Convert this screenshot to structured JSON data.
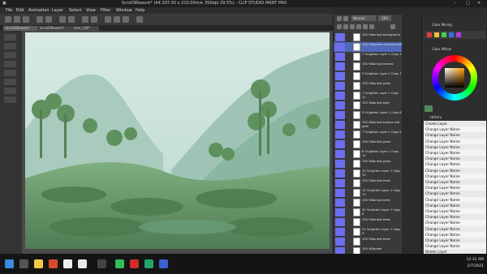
{
  "window": {
    "title": "Scroll3Rework* (A4 297.00 x 210.00mm 350dpi 29.5%) - CLIP STUDIO PAINT PRO"
  },
  "menu": [
    "File",
    "Edit",
    "Animation",
    "Layer",
    "Select",
    "View",
    "Filter",
    "Window",
    "Help"
  ],
  "doc_tabs": [
    "Scroll3Rework*",
    "Scroll3Rework*",
    "tree_v28*"
  ],
  "layer_panel": {
    "blend_mode": "Normal",
    "opacity": "100",
    "layers": [
      {
        "label": "100 %Normal background",
        "selected": false
      },
      {
        "label": "100 %Normal multiplyfusl2",
        "selected": true
      },
      {
        "label": "7 %Lighten Layer 1 Copy 4",
        "selected": false
      },
      {
        "label": "100 %Normal bushes",
        "selected": false
      },
      {
        "label": "5 %Lighten Layer 1 Copy 7",
        "selected": false
      },
      {
        "label": "100 %Normal grass",
        "selected": false
      },
      {
        "label": "7 %Lighten Layer 1 Copy 11",
        "selected": false
      },
      {
        "label": "100 %Normal path",
        "selected": false
      },
      {
        "label": "9 %Lighten Layer 1 Copy 6",
        "selected": false
      },
      {
        "label": "100 %Normal bushes and path",
        "selected": false
      },
      {
        "label": "7 %Lighten Layer 1 Copy 5",
        "selected": false
      },
      {
        "label": "100 %Normal grass",
        "selected": false
      },
      {
        "label": "8 %Lighten Layer 1 Copy 12",
        "selected": false
      },
      {
        "label": "100 %Normal grass",
        "selected": false
      },
      {
        "label": "10 %Lighten Layer 1 Copy 10",
        "selected": false
      },
      {
        "label": "100 %Normal trees",
        "selected": false
      },
      {
        "label": "12 %Lighten Layer 1 Copy 13",
        "selected": false
      },
      {
        "label": "100 %Normal trees",
        "selected": false
      },
      {
        "label": "20 %Lighten Layer 1 Copy 8",
        "selected": false
      },
      {
        "label": "100 %Normal trees",
        "selected": false
      },
      {
        "label": "21 %Lighten Layer 1 Copy 9",
        "selected": false
      },
      {
        "label": "100 %Normal trees",
        "selected": false
      },
      {
        "label": "100 %Darken",
        "selected": false
      }
    ]
  },
  "right_panel": {
    "color_mixing_label": "Color Mixing",
    "color_wheel_label": "Color Wheel",
    "history_label": "History",
    "history": [
      "Create Layer",
      "Change Layer Name",
      "Change Layer Name",
      "Change Layer Name",
      "Change Layer Name",
      "Change Layer Name",
      "Change Layer Name",
      "Change Layer Name",
      "Change Layer Name",
      "Change Layer Name",
      "Change Layer Name",
      "Change Layer Name",
      "Change Layer Name",
      "Change Layer Name",
      "Change Layer Name",
      "Change Layer Name",
      "Change Layer Name",
      "Change Layer Name",
      "Change Layer Name",
      "Change Layer Name",
      "Change Layer Name",
      "Change Layer Name",
      "Delete Layer",
      "Change Layer Name",
      "Change Layer Name",
      "Change Layer Name"
    ]
  },
  "taskbar": {
    "time": "12:31 AM",
    "date": "2/7/2021"
  },
  "colors": {
    "selected_layer": "#4f68b7",
    "layer_color_tag": "#6d6ff0",
    "canvas_sky": "#cde4dc"
  }
}
